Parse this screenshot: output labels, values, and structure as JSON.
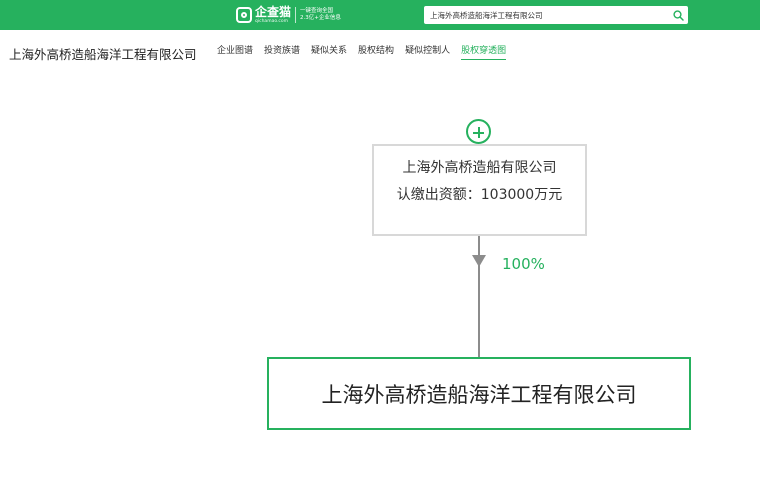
{
  "topbar": {
    "logo_name": "企查猫",
    "logo_domain": "qichamao.com",
    "slogan_line1": "一键查询全国",
    "slogan_line2": "2.3亿+企业信息",
    "search_value": "上海外高桥造船海洋工程有限公司",
    "brand_color": "#26b15e"
  },
  "header": {
    "company_title": "上海外高桥造船海洋工程有限公司",
    "nav": [
      {
        "label": "企业图谱"
      },
      {
        "label": "投资族谱"
      },
      {
        "label": "疑似关系"
      },
      {
        "label": "股权结构"
      },
      {
        "label": "疑似控制人"
      },
      {
        "label": "股权穿透图",
        "active": true
      }
    ]
  },
  "graph": {
    "parent": {
      "name": "上海外高桥造船有限公司",
      "capital": "认缴出资额：103000万元"
    },
    "edge_percent": "100%",
    "main": {
      "name": "上海外高桥造船海洋工程有限公司"
    }
  }
}
